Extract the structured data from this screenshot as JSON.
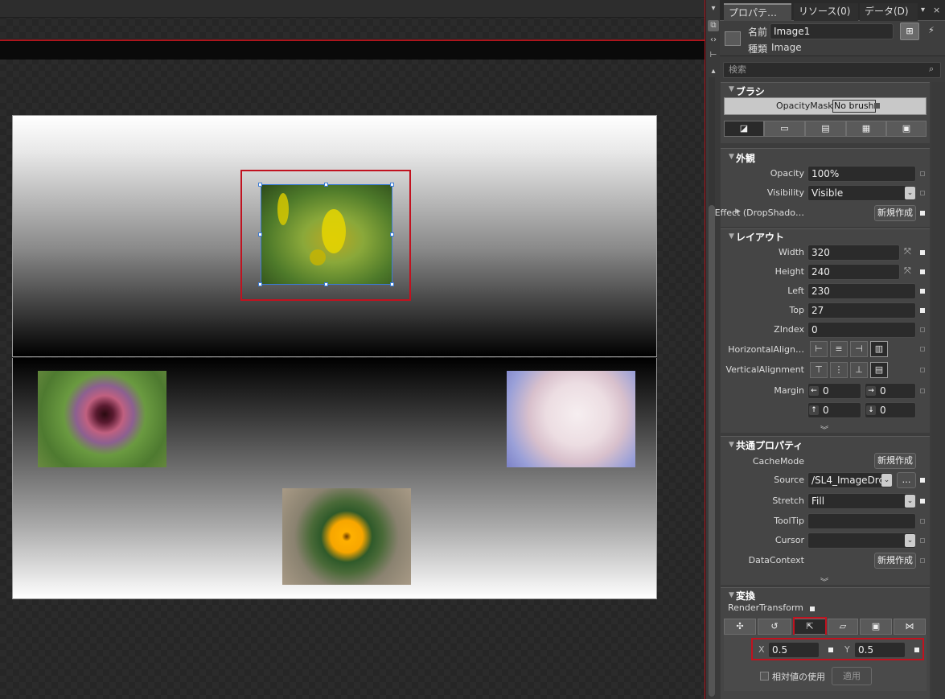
{
  "panel": {
    "tabs": [
      "プロパテ…",
      "リソース(0)",
      "データ(D)"
    ],
    "tab_close": "×",
    "pin_icon": "pin-icon",
    "name_label": "名前",
    "name_value": "Image1",
    "type_label": "種類",
    "type_value": "Image",
    "search_placeholder": "検索"
  },
  "brush": {
    "title": "ブラシ",
    "opacity_mask_label": "OpacityMask",
    "opacity_mask_value": "No brush"
  },
  "appearance": {
    "title": "外観",
    "opacity_label": "Opacity",
    "opacity_value": "100%",
    "visibility_label": "Visibility",
    "visibility_value": "Visible",
    "effect_label": "Effect (DropShado…",
    "effect_button": "新規作成"
  },
  "layout": {
    "title": "レイアウト",
    "width_label": "Width",
    "width_value": "320",
    "height_label": "Height",
    "height_value": "240",
    "left_label": "Left",
    "left_value": "230",
    "top_label": "Top",
    "top_value": "27",
    "zindex_label": "ZIndex",
    "zindex_value": "0",
    "halign_label": "HorizontalAlign…",
    "valign_label": "VerticalAlignment",
    "margin_label": "Margin",
    "margin_left": "0",
    "margin_right": "0",
    "margin_top": "0",
    "margin_bottom": "0"
  },
  "common": {
    "title": "共通プロパティ",
    "cachemode_label": "CacheMode",
    "cachemode_button": "新規作成",
    "source_label": "Source",
    "source_value": "/SL4_ImageDro",
    "source_browse": "…",
    "stretch_label": "Stretch",
    "stretch_value": "Fill",
    "tooltip_label": "ToolTip",
    "tooltip_value": "",
    "cursor_label": "Cursor",
    "cursor_value": "",
    "datacontext_label": "DataContext",
    "datacontext_button": "新規作成"
  },
  "transform": {
    "title": "変換",
    "render_label": "RenderTransform",
    "x_label": "X",
    "x_value": "0.5",
    "y_label": "Y",
    "y_value": "0.5",
    "relative_label": "相対値の使用",
    "apply_button": "適用"
  },
  "accent": "#c1121f"
}
